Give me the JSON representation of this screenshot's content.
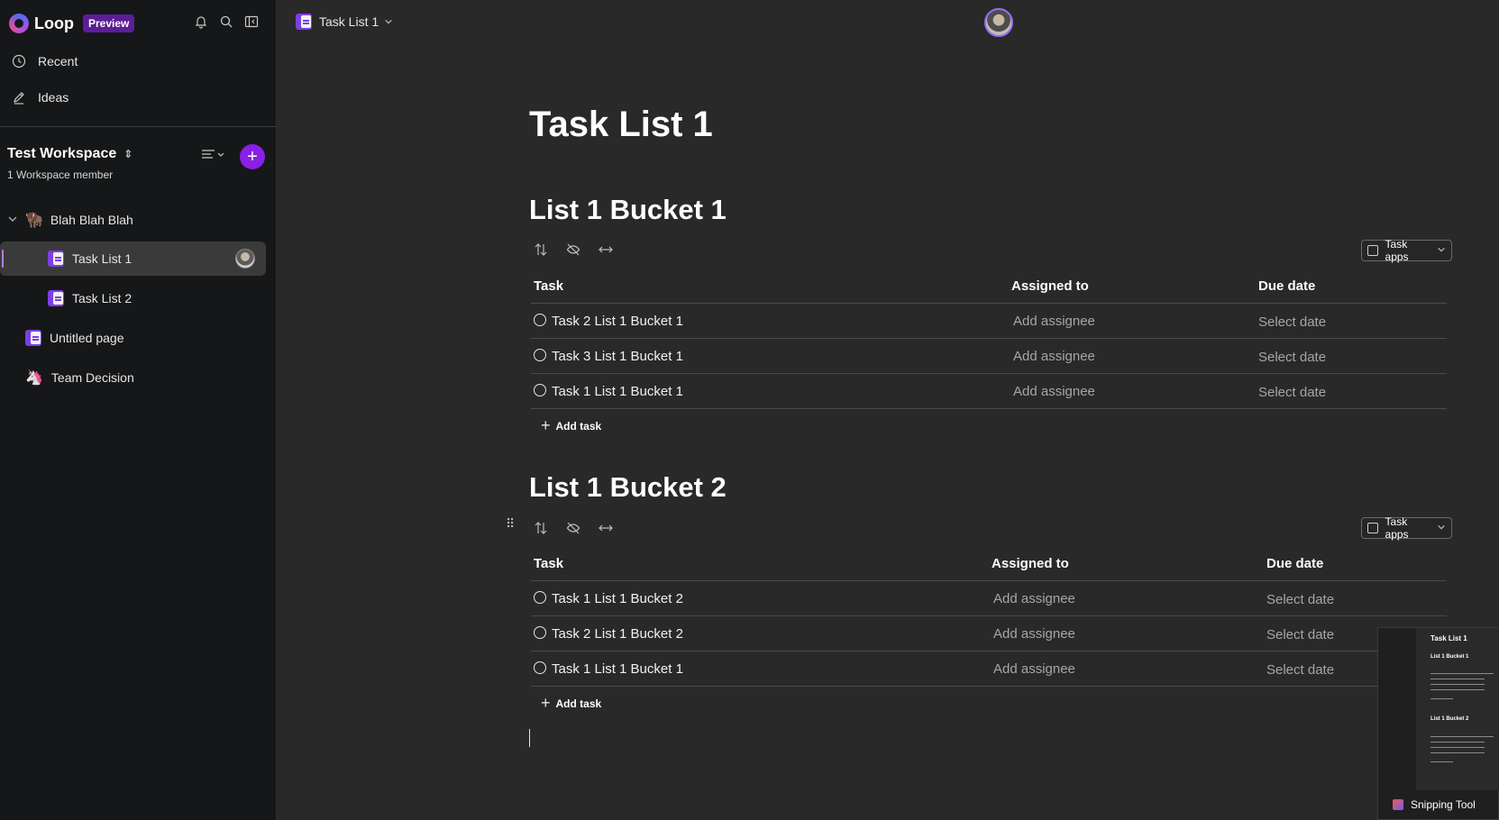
{
  "sidebar": {
    "brand": "Loop",
    "badge": "Preview",
    "nav": {
      "recent": "Recent",
      "ideas": "Ideas"
    },
    "workspace": {
      "name": "Test Workspace",
      "members": "1 Workspace member"
    },
    "tree": {
      "folder": "Blah Blah Blah",
      "items": [
        "Task List 1",
        "Task List 2",
        "Untitled page",
        "Team Decision"
      ]
    }
  },
  "header": {
    "breadcrumb": "Task List 1"
  },
  "doc": {
    "title": "Task List 1",
    "buckets": [
      {
        "title": "List 1 Bucket 1",
        "task_apps": "Task apps",
        "columns": {
          "task": "Task",
          "assigned": "Assigned to",
          "due": "Due date"
        },
        "rows": [
          {
            "task": "Task 2 List 1 Bucket 1",
            "assignee": "Add assignee",
            "date": "Select date"
          },
          {
            "task": "Task 3 List 1 Bucket 1",
            "assignee": "Add assignee",
            "date": "Select date"
          },
          {
            "task": "Task 1 List 1 Bucket 1",
            "assignee": "Add assignee",
            "date": "Select date"
          }
        ],
        "add_task": "Add task"
      },
      {
        "title": "List 1 Bucket 2",
        "task_apps": "Task apps",
        "columns": {
          "task": "Task",
          "assigned": "Assigned to",
          "due": "Due date"
        },
        "rows": [
          {
            "task": "Task 1 List 1 Bucket 2",
            "assignee": "Add assignee",
            "date": "Select date"
          },
          {
            "task": "Task 2 List 1 Bucket 2",
            "assignee": "Add assignee",
            "date": "Select date"
          },
          {
            "task": "Task 1 List 1 Bucket 1",
            "assignee": "Add assignee",
            "date": "Select date"
          }
        ],
        "add_task": "Add task"
      }
    ]
  },
  "snipping_tool": {
    "label": "Snipping Tool",
    "preview_title": "Task List 1",
    "preview_bucket1": "List 1 Bucket 1",
    "preview_bucket2": "List 1 Bucket 2"
  },
  "colors": {
    "accent": "#8a1fe6",
    "badge": "#5b1e97",
    "background": "#292929",
    "sidebar": "#161718"
  }
}
